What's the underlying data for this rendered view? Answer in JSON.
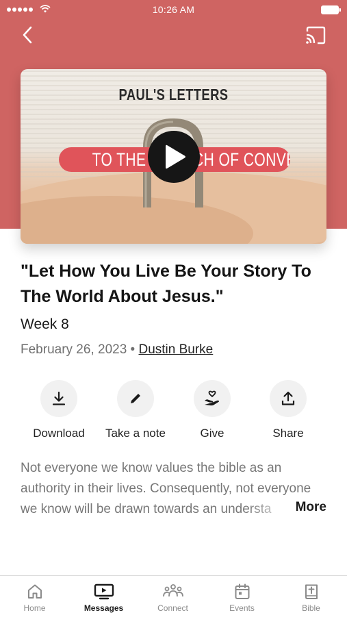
{
  "status_bar": {
    "time": "10:26 AM"
  },
  "artwork": {
    "series_title": "PAUL'S LETTERS",
    "series_subtitle": "TO THE CHURCH OF CONVERGE"
  },
  "message": {
    "title": "\"Let How You Live Be Your Story To The World About Jesus.\"",
    "week": "Week 8",
    "date": "February 26, 2023",
    "separator": "•",
    "speaker": "Dustin Burke"
  },
  "actions": [
    {
      "label": "Download",
      "icon": "download-icon"
    },
    {
      "label": "Take a note",
      "icon": "pencil-icon"
    },
    {
      "label": "Give",
      "icon": "give-icon"
    },
    {
      "label": "Share",
      "icon": "share-icon"
    }
  ],
  "description": {
    "text": "Not everyone we know values the bible as an authority in their lives. Consequently, not everyone we know will be drawn towards an understa",
    "more_label": "More"
  },
  "tabs": [
    {
      "label": "Home",
      "icon": "home-icon",
      "active": false
    },
    {
      "label": "Messages",
      "icon": "messages-tv-icon",
      "active": true
    },
    {
      "label": "Connect",
      "icon": "people-icon",
      "active": false
    },
    {
      "label": "Events",
      "icon": "calendar-icon",
      "active": false
    },
    {
      "label": "Bible",
      "icon": "bible-icon",
      "active": false
    }
  ],
  "colors": {
    "hero_background": "#cf6462",
    "banner_red": "#e0545a",
    "play_button": "#161616",
    "action_circle": "#f1f1f1"
  }
}
